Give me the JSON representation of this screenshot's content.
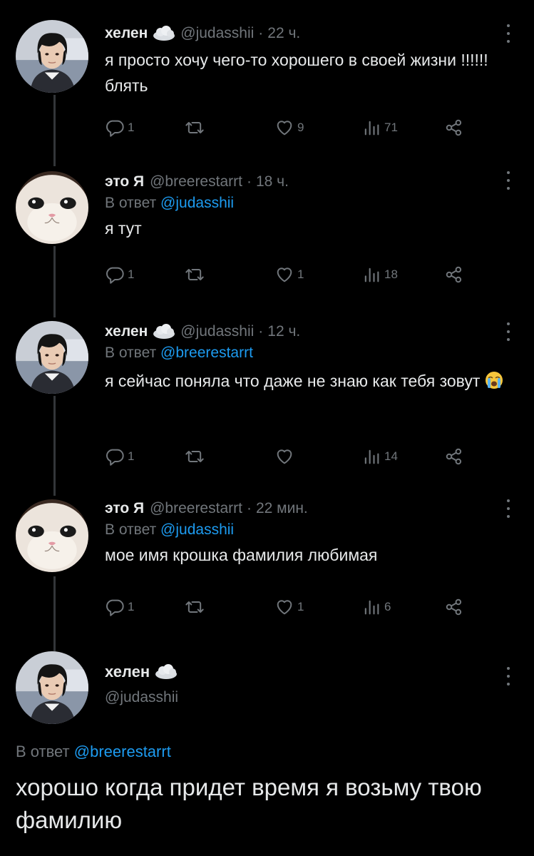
{
  "tweets": [
    {
      "name": "хелен",
      "handle": "@judasshii",
      "time": "22 ч.",
      "reply_prefix": "",
      "reply_to": "",
      "text": "я просто хочу чего-то хорошего в своей жизни !!!!!! блять",
      "avatar": "girl-avatar",
      "has_cloud": true,
      "stats": {
        "replies": "1",
        "retweets": "",
        "likes": "9",
        "views": "71"
      }
    },
    {
      "name": "это Я",
      "handle": "@breerestarrt",
      "time": "18 ч.",
      "reply_prefix": "В ответ",
      "reply_to": "@judasshii",
      "text": "я тут",
      "avatar": "cat-avatar",
      "has_cloud": false,
      "stats": {
        "replies": "1",
        "retweets": "",
        "likes": "1",
        "views": "18"
      }
    },
    {
      "name": "хелен",
      "handle": "@judasshii",
      "time": "12 ч.",
      "reply_prefix": "В ответ",
      "reply_to": "@breerestarrt",
      "text": "я сейчас поняла что даже не знаю как тебя зовут",
      "emoji": "crying-face-emoji",
      "avatar": "girl-avatar",
      "has_cloud": true,
      "stats": {
        "replies": "1",
        "retweets": "",
        "likes": "",
        "views": "14"
      }
    },
    {
      "name": "это Я",
      "handle": "@breerestarrt",
      "time": "22 мин.",
      "reply_prefix": "В ответ",
      "reply_to": "@judasshii",
      "text": "мое имя крошка фамилия любимая",
      "avatar": "cat-avatar",
      "has_cloud": false,
      "stats": {
        "replies": "1",
        "retweets": "",
        "likes": "1",
        "views": "6"
      }
    }
  ],
  "main_tweet": {
    "name": "хелен",
    "handle": "@judasshii",
    "reply_prefix": "В ответ",
    "reply_to": "@breerestarrt",
    "text": "хорошо когда придет время я возьму твою фамилию",
    "avatar": "girl-avatar"
  },
  "colors": {
    "background": "#000000",
    "text": "#e7e9ea",
    "muted": "#71767b",
    "link": "#1d9bf0",
    "thread_line": "#333639"
  },
  "icons": [
    "reply-icon",
    "retweet-icon",
    "like-icon",
    "views-icon",
    "share-icon",
    "more-icon",
    "cloud-icon"
  ]
}
